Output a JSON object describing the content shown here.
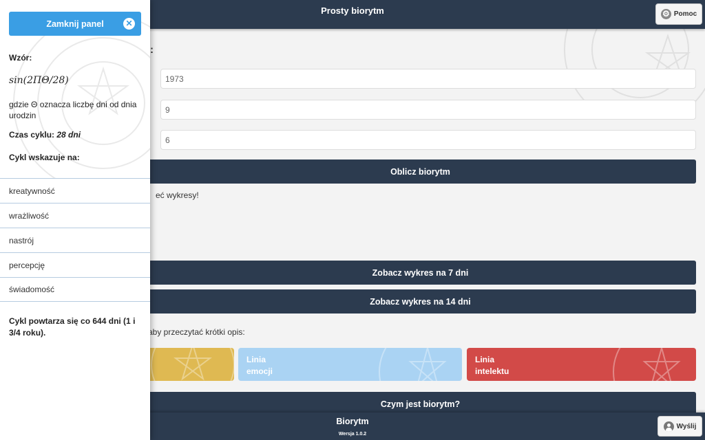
{
  "header": {
    "title": "Prosty biorytm",
    "help_label": "Pomoc"
  },
  "form": {
    "colon": ":",
    "year_value": "1973",
    "month_value": "9",
    "day_value": "6",
    "calc_button": "Oblicz biorytm",
    "charts_text": "eć wykresy!"
  },
  "charts": {
    "week_button": "Zobacz wykres na 7 dni",
    "two_weeks_button": "Zobacz wykres na 14 dni"
  },
  "info_text": "r, aby przeczytać krótki opis:",
  "cards": [
    {
      "line1": "",
      "line2": "",
      "color": "#dfb952"
    },
    {
      "line1": "Linia",
      "line2": "emocji",
      "color": "#aad3f3"
    },
    {
      "line1": "Linia",
      "line2": "intelektu",
      "color": "#d24a48"
    }
  ],
  "what_is_button": "Czym jest biorytm?",
  "footer": {
    "app_name": "Biorytm",
    "version": "Wersja 1.0.2",
    "send_label": "Wyślij"
  },
  "panel": {
    "close_label": "Zamknij panel",
    "formula_label": "Wzór:",
    "formula": "sin(2ΠΘ/28)",
    "where_text": "gdzie Θ oznacza liczbę dni od dnia urodzin",
    "cycle_time_label": "Czas cyklu:",
    "cycle_time_value": "28 dni",
    "indicates_label": "Cykl wskazuje na:",
    "items": [
      "kreatywność",
      "wrażliwość",
      "nastrój",
      "percepcję",
      "świadomość"
    ],
    "repeat_text": "Cykl powtarza się co 644 dni (1 i 3/4 roku)."
  }
}
